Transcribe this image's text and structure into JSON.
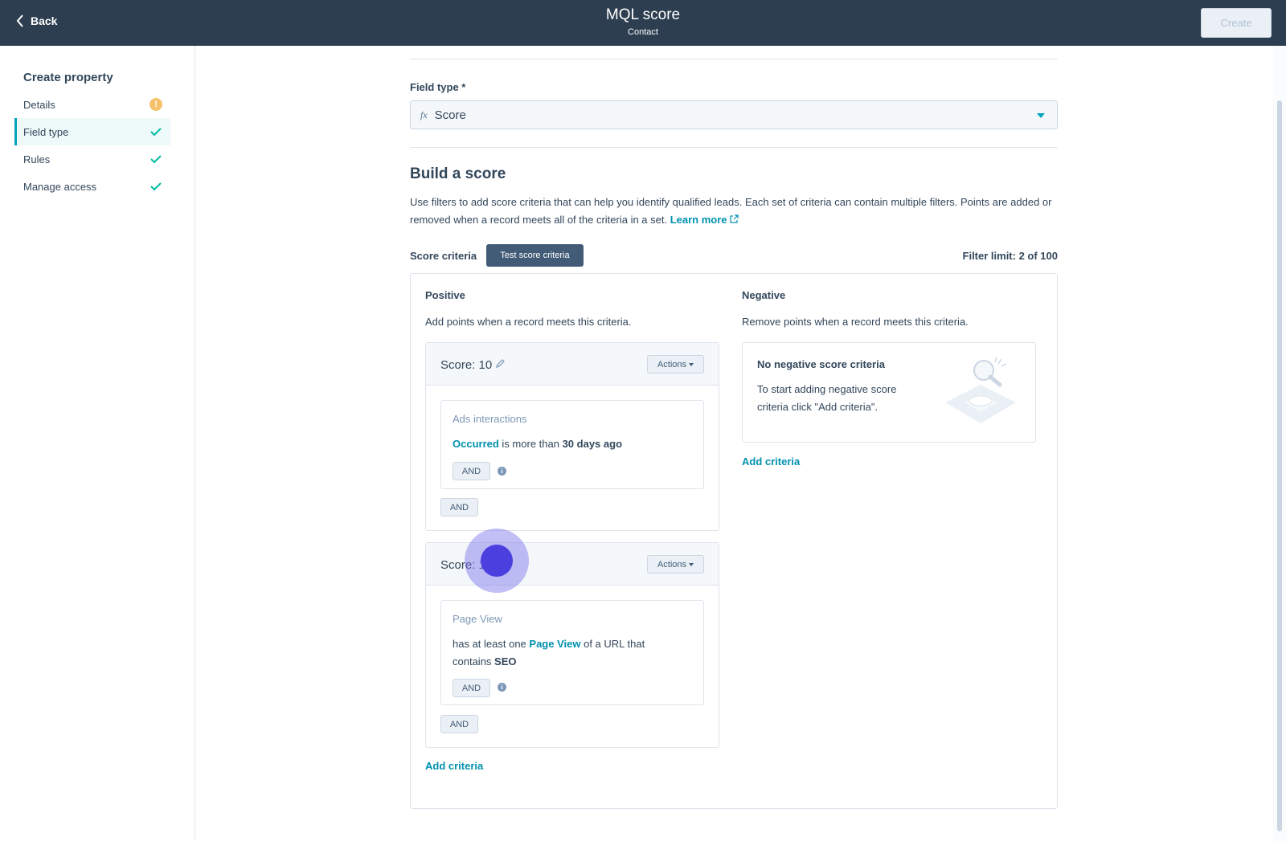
{
  "header": {
    "back_label": "Back",
    "title": "MQL score",
    "subtitle": "Contact",
    "create_label": "Create"
  },
  "sidebar": {
    "title": "Create property",
    "items": [
      {
        "label": "Details",
        "status": "warning"
      },
      {
        "label": "Field type",
        "status": "complete",
        "active": true
      },
      {
        "label": "Rules",
        "status": "complete"
      },
      {
        "label": "Manage access",
        "status": "complete"
      }
    ]
  },
  "main": {
    "field_type_label": "Field type *",
    "field_type_icon": "fx",
    "field_type_value": "Score",
    "build_title": "Build a score",
    "build_desc": "Use filters to add score criteria that can help you identify qualified leads. Each set of criteria can contain multiple filters. Points are added or removed when a record meets all of the criteria in a set.",
    "learn_more": "Learn more",
    "score_criteria_label": "Score criteria",
    "test_button": "Test score criteria",
    "filter_limit": "Filter limit: 2 of 100",
    "positive": {
      "title": "Positive",
      "desc": "Add points when a record meets this criteria.",
      "cards": [
        {
          "score_label": "Score: 10",
          "actions_label": "Actions",
          "filter_name": "Ads interactions",
          "filter_parts": {
            "link": "Occurred",
            "middle": " is more than ",
            "bold": "30 days ago"
          },
          "inner_and": "AND",
          "outer_and": "AND"
        },
        {
          "score_label": "Score: 1",
          "actions_label": "Actions",
          "filter_name": "Page View",
          "filter_parts": {
            "pre": "has at least one ",
            "link": "Page View",
            "middle": " of a URL that contains ",
            "bold": "SEO"
          },
          "inner_and": "AND",
          "outer_and": "AND"
        }
      ],
      "add_criteria": "Add criteria"
    },
    "negative": {
      "title": "Negative",
      "desc": "Remove points when a record meets this criteria.",
      "empty_title": "No negative score criteria",
      "empty_desc": "To start adding negative score criteria click \"Add criteria\".",
      "add_criteria": "Add criteria"
    }
  },
  "colors": {
    "header_bg": "#2d3e50",
    "accent": "#00a4bd",
    "link": "#0091ae",
    "success": "#00bda5",
    "warning": "#f5c26b",
    "button_dark": "#425b76"
  }
}
